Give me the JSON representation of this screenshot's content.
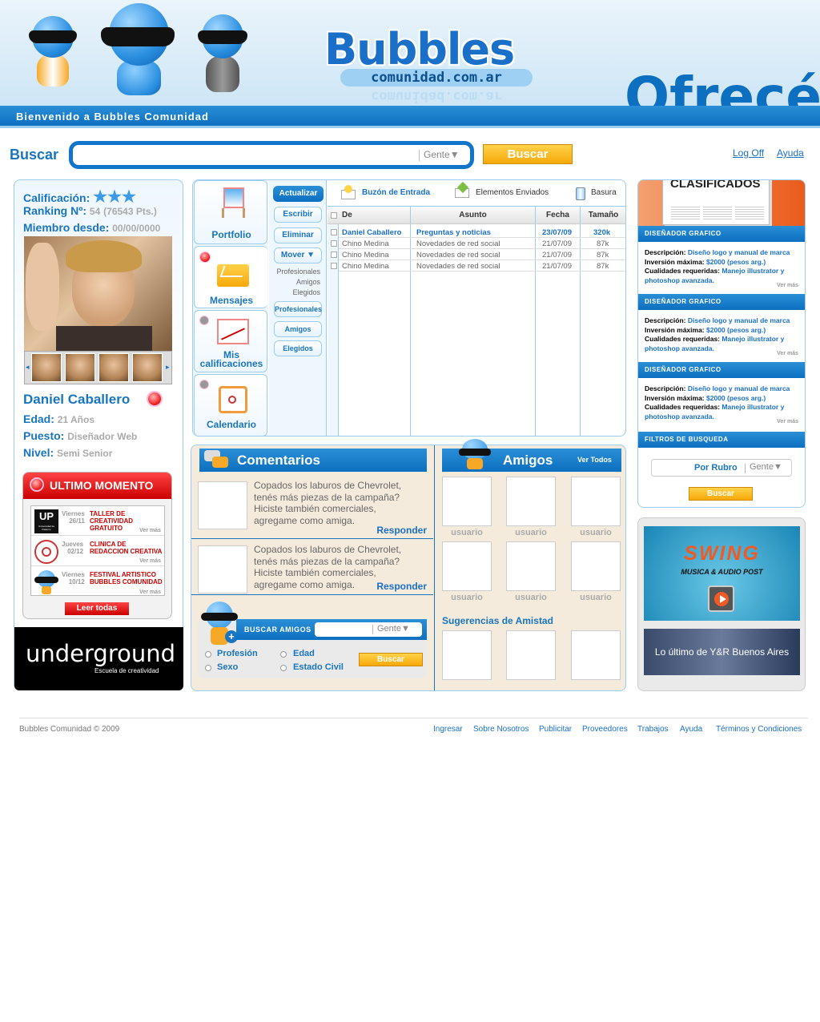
{
  "header": {
    "welcome": "Bienvenido a Bubbles Comunidad",
    "logo_main": "Bubbles",
    "logo_sub": "comunidad.com.ar",
    "promo": "Ofrecé"
  },
  "search": {
    "label": "Buscar",
    "placeholder": "",
    "filter": "Gente▼",
    "button": "Buscar"
  },
  "top_links": {
    "logoff": "Log Off",
    "help": "Ayuda"
  },
  "profile": {
    "rating_label": "Calificación:",
    "rating_stars": 3,
    "ranking_label": "Ranking Nº:",
    "ranking_value": "54",
    "ranking_points": "(76543 Pts.)",
    "member_label": "Miembro desde:",
    "member_value": "00/00/0000",
    "name": "Daniel Caballero",
    "age_label": "Edad:",
    "age_value": "21 Años",
    "position_label": "Puesto:",
    "position_value": "Diseñador Web",
    "level_label": "Nivel:",
    "level_value": "Semi Senior"
  },
  "ultimo_momento": {
    "title": "ULTIMO MOMENTO",
    "items": [
      {
        "logo": "UP",
        "logo_sub": "Universidad de Palermo",
        "day": "Viernes",
        "date": "26/11",
        "title": "TALLER DE CREATIVIDAD GRATUITO",
        "more": "Ver más"
      },
      {
        "logo": "",
        "day": "Jueves",
        "date": "02/12",
        "title": "CLINICA DE REDACCION CREATIVA",
        "more": "Ver más"
      },
      {
        "logo": "",
        "day": "Viernes",
        "date": "10/12",
        "title": "FESTIVAL ARTISTICO BUBBLES COMUNIDAD",
        "more": "Ver más"
      }
    ],
    "read_all": "Leer todas"
  },
  "underground": {
    "title": "underground",
    "subtitle": "Escuela de creatividad"
  },
  "mail": {
    "tabs": [
      "Portfolio",
      "Mensajes",
      "Mis calificaciones",
      "Calendario"
    ],
    "refresh": "Actualizar",
    "folders": [
      "Buzón de Entrada",
      "Elementos Enviados",
      "Basura"
    ],
    "commands": {
      "write": "Escribir",
      "delete": "Eliminar",
      "move": "Mover ▼"
    },
    "move_options": [
      "Profesionales",
      "Amigos",
      "Elegidos"
    ],
    "filters": [
      "Profesionales",
      "Amigos",
      "Elegidos"
    ],
    "columns": {
      "from": "De",
      "subject": "Asunto",
      "date": "Fecha",
      "size": "Tamaño"
    },
    "rows": [
      {
        "from": "Daniel Caballero",
        "subject": "Preguntas y noticias",
        "date": "23/07/09",
        "size": "320k",
        "unread": true
      },
      {
        "from": "Chino Medina",
        "subject": "Novedades de red social",
        "date": "21/07/09",
        "size": "87k",
        "unread": false
      },
      {
        "from": "Chino Medina",
        "subject": "Novedades de red social",
        "date": "21/07/09",
        "size": "87k",
        "unread": false
      },
      {
        "from": "Chino Medina",
        "subject": "Novedades de red social",
        "date": "21/07/09",
        "size": "87k",
        "unread": false
      }
    ]
  },
  "comments": {
    "title": "Comentarios",
    "items": [
      {
        "text": "Copados los laburos de Chevrolet, tenés más piezas de la campaña? Hiciste también comerciales, agregame como amiga.",
        "reply": "Responder"
      },
      {
        "text": "Copados los laburos de Chevrolet, tenés más piezas de la campaña? Hiciste también comerciales, agregame como amiga.",
        "reply": "Responder"
      }
    ]
  },
  "friends": {
    "title": "Amigos",
    "see_all": "Ver Todos",
    "names": [
      "usuario",
      "usuario",
      "usuario",
      "usuario",
      "usuario",
      "usuario"
    ],
    "suggestions_title": "Sugerencias de Amistad"
  },
  "find_friends": {
    "title": "BUSCAR AMIGOS",
    "filter": "Gente▼",
    "options": [
      "Profesión",
      "Edad",
      "Sexo",
      "Estado Civil"
    ],
    "button": "Buscar"
  },
  "classifieds": {
    "title": "CLASIFICADOS",
    "items": [
      {
        "heading": "DISEÑADOR GRAFICO",
        "desc_label": "Descripción:",
        "desc": "Diseño logo y manual de marca",
        "inv_label": "Inversión máxima:",
        "inv": "$2000 (pesos arg.)",
        "qual_label": "Cualidades requeridas:",
        "qual": "Manejo illustrator y photoshop avanzada.",
        "more": "Ver más"
      },
      {
        "heading": "DISEÑADOR GRAFICO",
        "desc_label": "Descripción:",
        "desc": "Diseño logo y manual de marca",
        "inv_label": "Inversión máxima:",
        "inv": "$2000 (pesos arg.)",
        "qual_label": "Cualidades requeridas:",
        "qual": "Manejo illustrator y photoshop avanzada.",
        "more": "Ver más"
      },
      {
        "heading": "DISEÑADOR GRAFICO",
        "desc_label": "Descripción:",
        "desc": "Diseño logo y manual de marca",
        "inv_label": "Inversión máxima:",
        "inv": "$2000 (pesos arg.)",
        "qual_label": "Cualidades requeridas:",
        "qual": "Manejo illustrator y photoshop avanzada.",
        "more": "Ver más"
      }
    ],
    "filters_title": "FILTROS DE BUSQUEDA",
    "by_category": "Por Rubro",
    "filter": "Gente▼",
    "button": "Buscar"
  },
  "ads": {
    "swing_title": "SWING",
    "swing_sub": "MUSICA & AUDIO POST",
    "yr": "Lo último de Y&R Buenos Aires"
  },
  "footer": {
    "copyright": "Bubbles Comunidad  © 2009",
    "links": [
      "Ingresar",
      "Sobre Nosotros",
      "Publicitar",
      "Proveedores",
      "Trabajos",
      "Ayuda",
      "Términos y Condiciones"
    ]
  },
  "colors": {
    "brand_blue": "#1176cb",
    "accent_orange": "#f6a90a",
    "alert_red": "#cc0000"
  }
}
